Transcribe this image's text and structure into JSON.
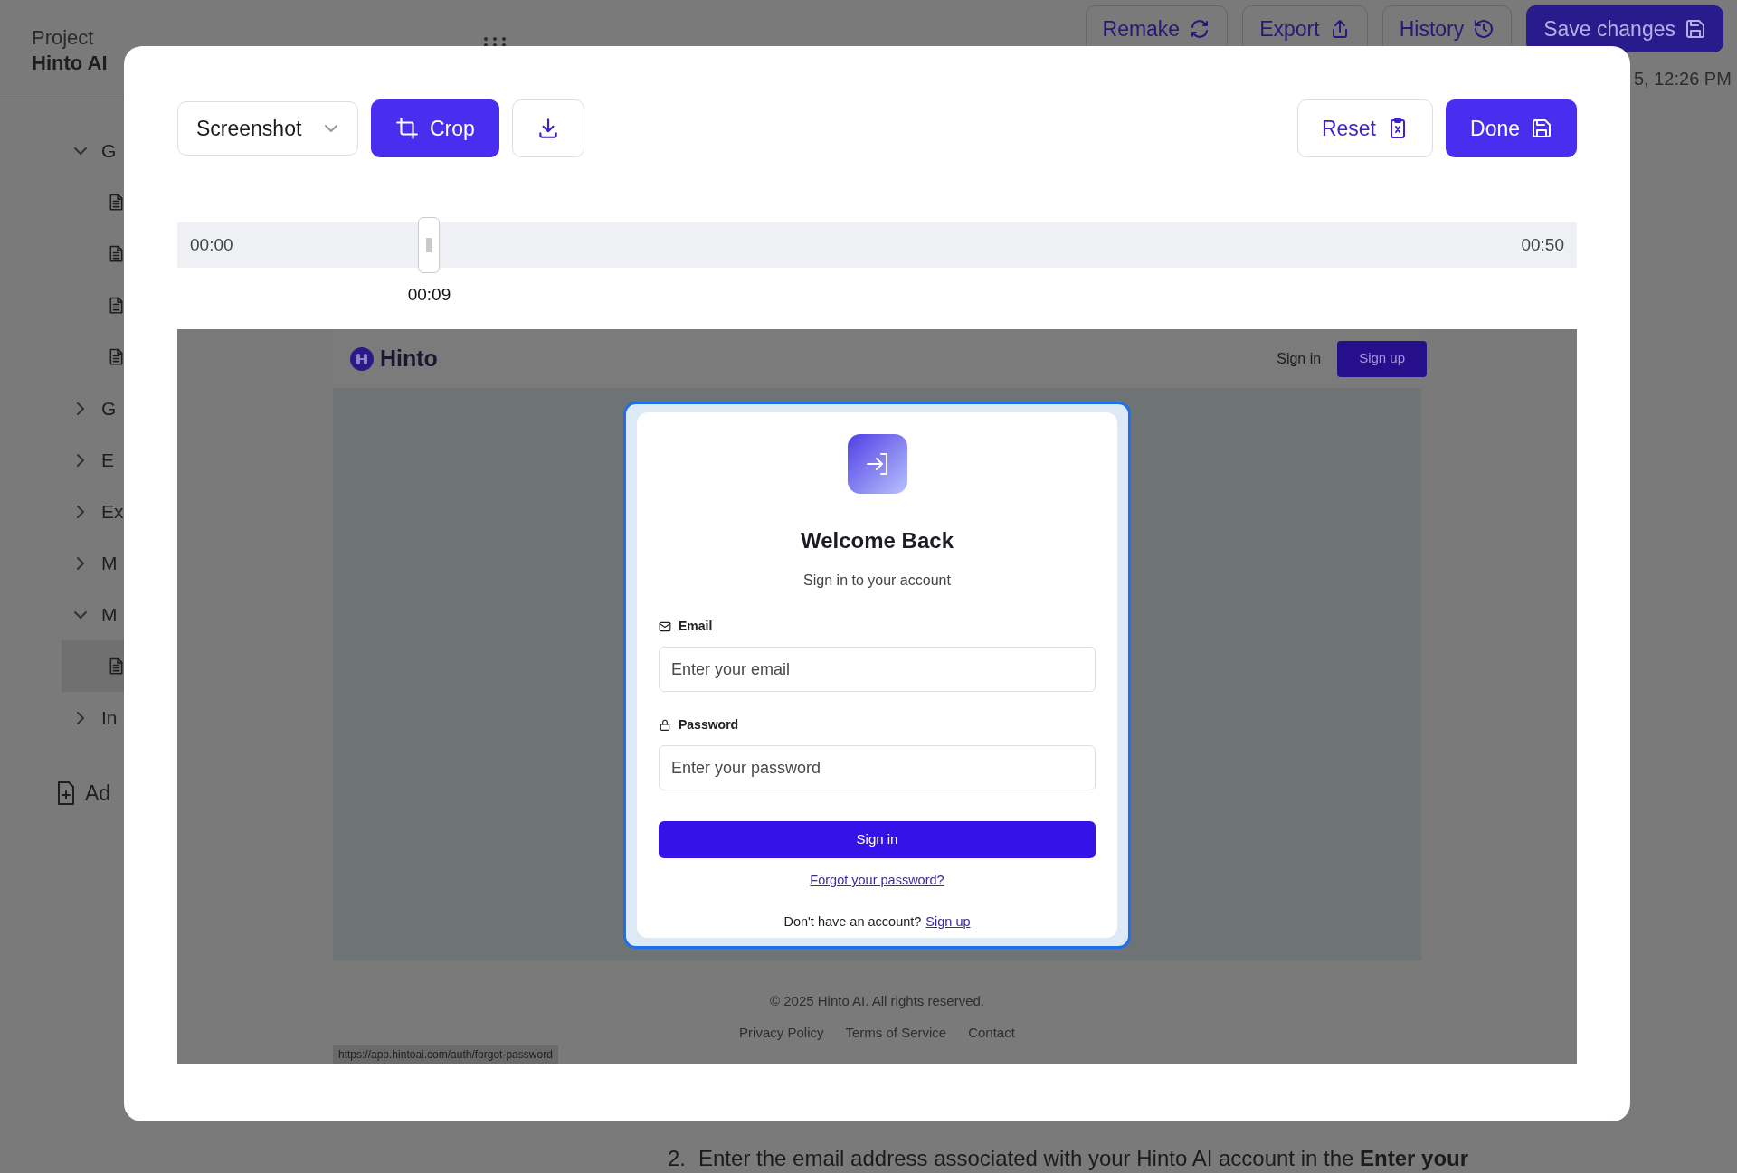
{
  "page": {
    "project_label": "Project",
    "project_name": "Hinto AI",
    "actions": [
      {
        "kind": "remake",
        "label": "Remake"
      },
      {
        "kind": "export",
        "label": "Export"
      },
      {
        "kind": "history",
        "label": "History"
      },
      {
        "kind": "save",
        "label": "Save changes"
      }
    ],
    "timestamp": "5, 12:26 PM",
    "tree": [
      {
        "label": "G",
        "expanded": true,
        "children": [
          {
            "selected": false
          },
          {
            "selected": false
          },
          {
            "selected": false
          },
          {
            "selected": false
          }
        ]
      },
      {
        "label": "G",
        "expanded": false
      },
      {
        "label": "E",
        "expanded": false
      },
      {
        "label": "Ex",
        "expanded": false
      },
      {
        "label": "M",
        "expanded": false
      },
      {
        "label": "M",
        "expanded": true,
        "children": [
          {
            "selected": true
          }
        ]
      },
      {
        "label": "In",
        "expanded": false
      }
    ],
    "add_label": "Ad",
    "step": {
      "number": "2.",
      "text": "Enter the email address associated with your Hinto AI account in the **Enter your**"
    }
  },
  "editor": {
    "source_select": "Screenshot",
    "tools": [
      {
        "kind": "crop",
        "label": "Crop",
        "selected": true
      },
      {
        "kind": "download",
        "selected": false
      }
    ],
    "reset": "Reset",
    "done": "Done",
    "timeline": {
      "start": "00:00",
      "end": "00:50",
      "current": "00:09",
      "level": 0.18
    },
    "preview": {
      "brand": "Hinto",
      "nav_sign_in": "Sign in",
      "nav_sign_up": "Sign up",
      "card": {
        "title": "Welcome Back",
        "subtitle": "Sign in to your account",
        "fields": [
          {
            "kind": "email",
            "label": "Email",
            "placeholder": "Enter your email"
          },
          {
            "kind": "password",
            "label": "Password",
            "placeholder": "Enter your password"
          }
        ],
        "submit": "Sign in",
        "forgot": "Forgot your password?",
        "signup_prompt": "Don't have an account?",
        "signup_link": "Sign up"
      },
      "footer": {
        "copyright": "© 2025 Hinto AI. All rights reserved.",
        "links": [
          "Privacy Policy",
          "Terms of Service",
          "Contact"
        ]
      },
      "status_url": "https://app.hintoai.com/auth/forgot-password"
    }
  }
}
